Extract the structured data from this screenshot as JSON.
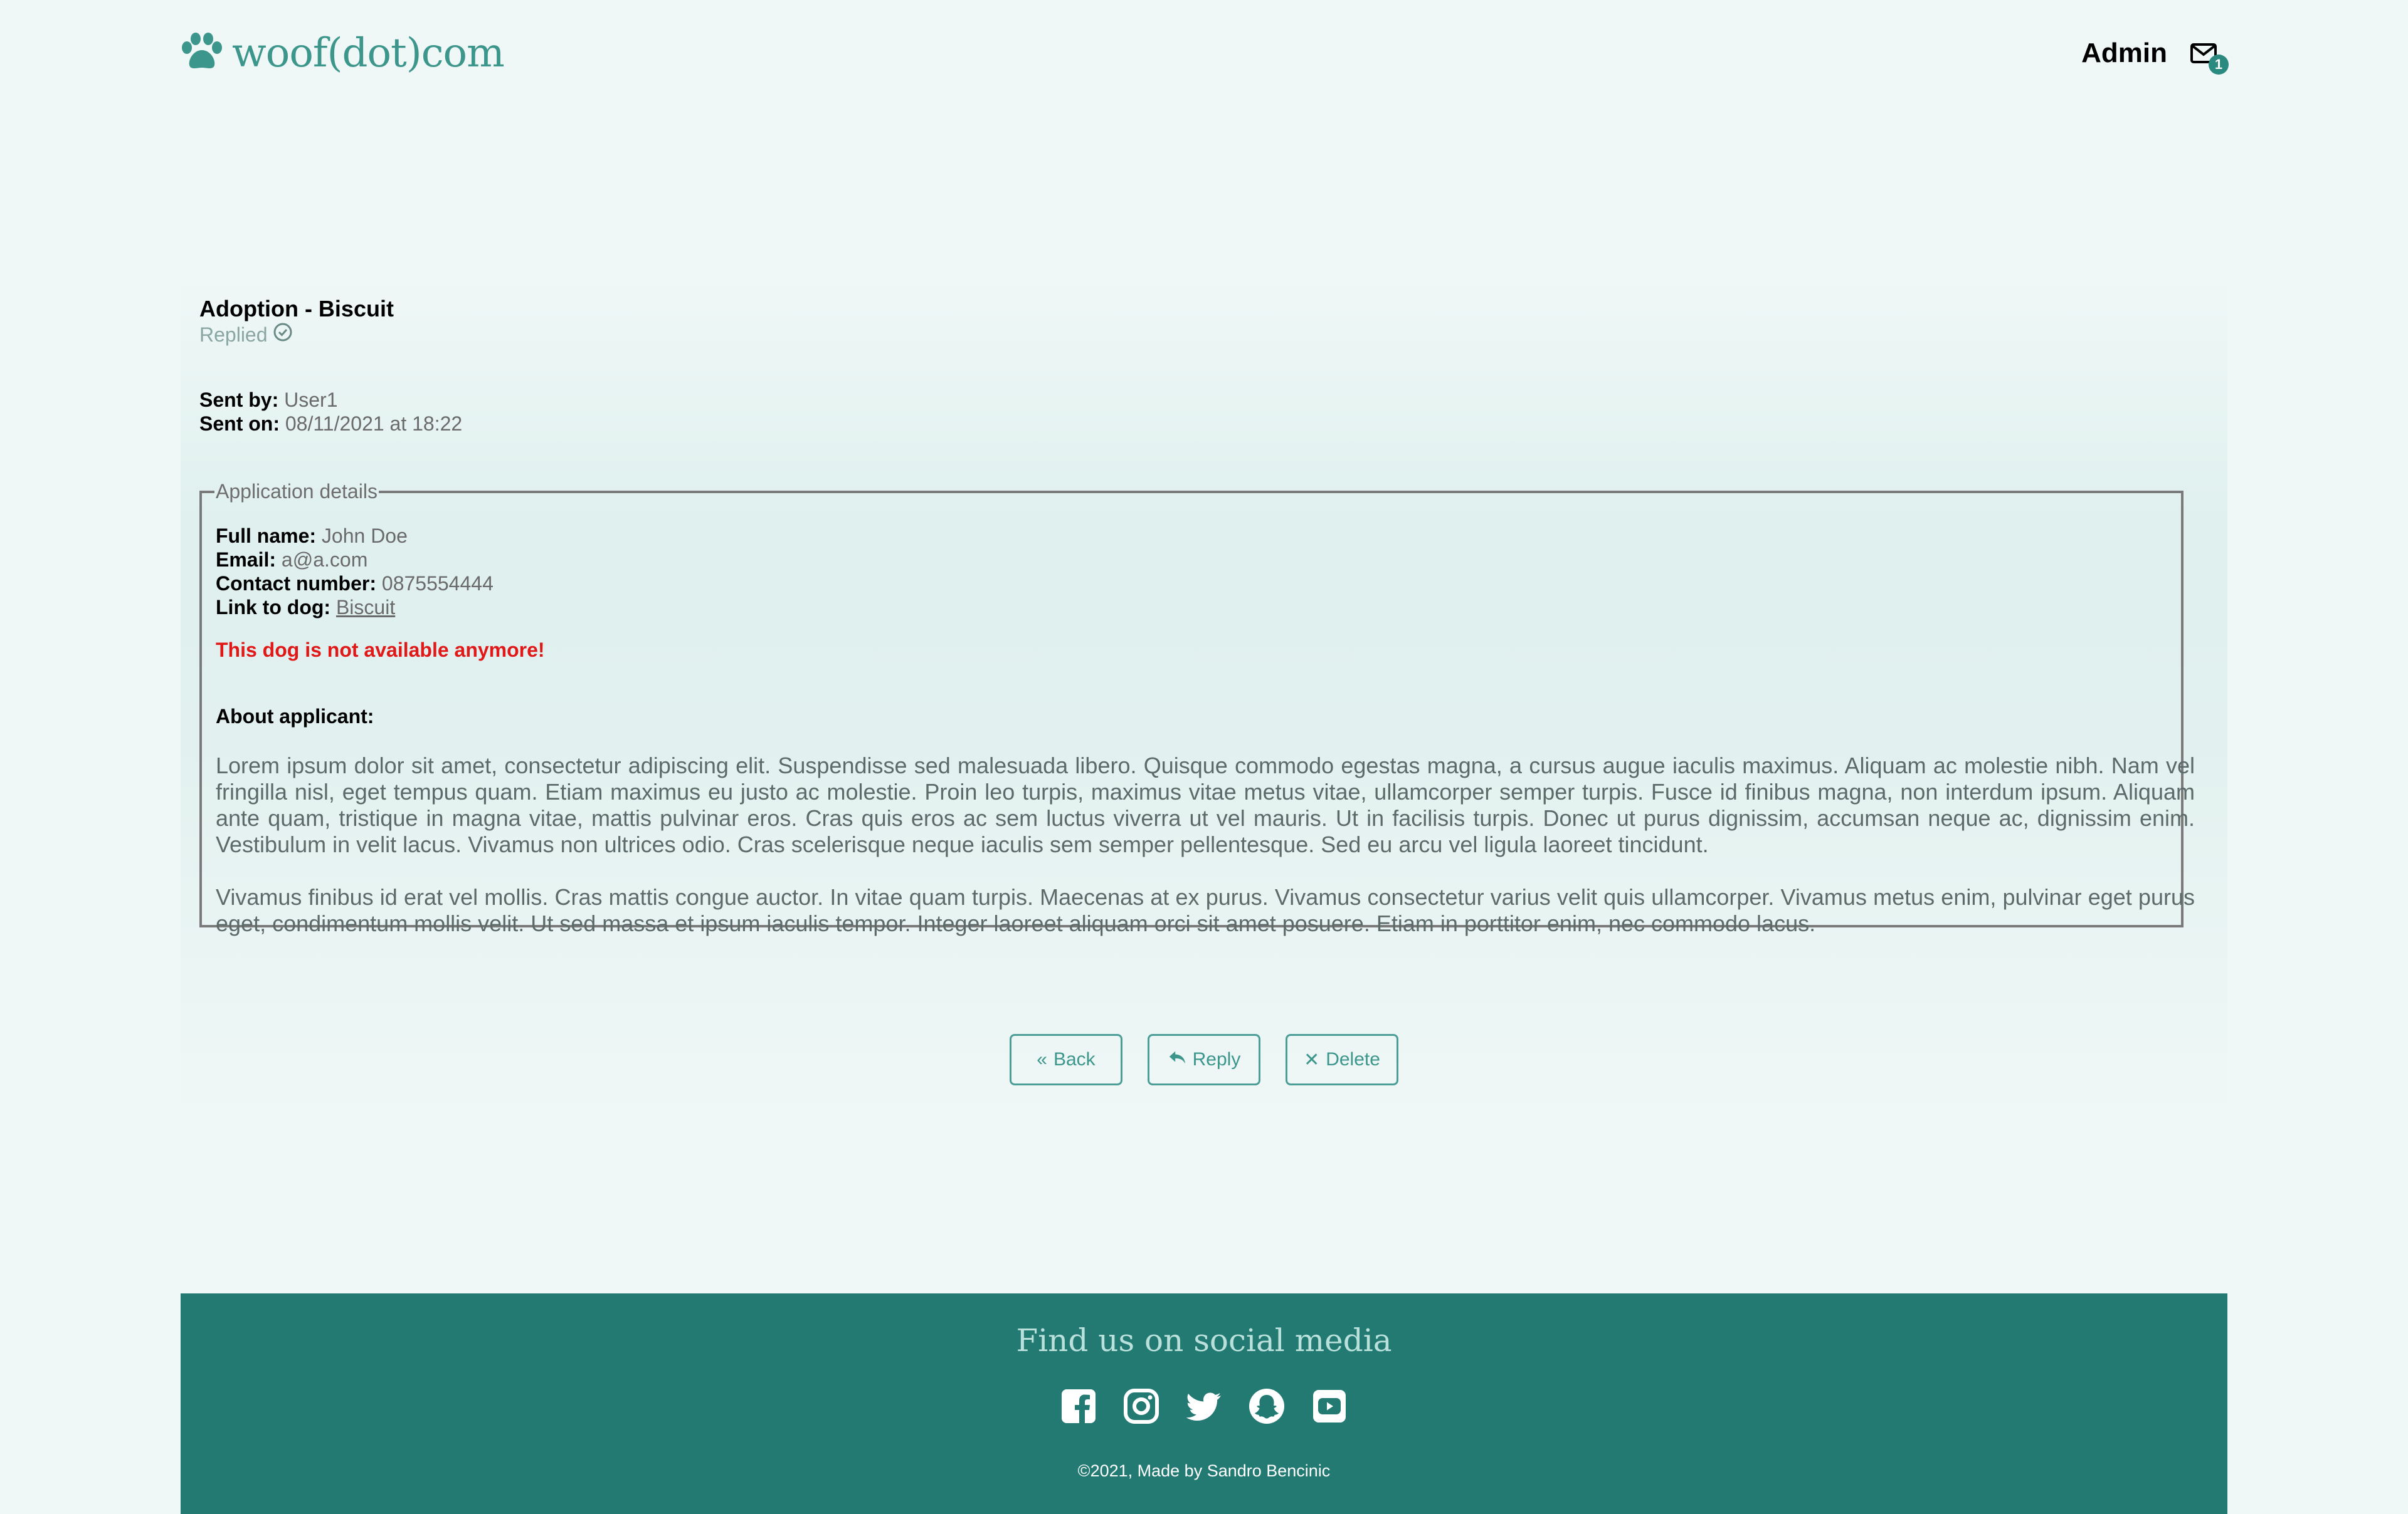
{
  "header": {
    "brand": "woof(dot)com",
    "admin_label": "Admin",
    "mail_count": "1"
  },
  "message": {
    "title": "Adoption - Biscuit",
    "status": "Replied",
    "sent_by_label": "Sent by:",
    "sent_by": "User1",
    "sent_on_label": "Sent on:",
    "sent_on": "08/11/2021 at 18:22"
  },
  "application": {
    "legend": "Application details",
    "full_name_label": "Full name:",
    "full_name": "John Doe",
    "email_label": "Email:",
    "email": "a@a.com",
    "contact_label": "Contact number:",
    "contact": "0875554444",
    "dog_label": "Link to dog:",
    "dog_link": "Biscuit",
    "warning": "This dog is not available anymore!",
    "about_label": "About applicant:",
    "paragraphs": [
      "Lorem ipsum dolor sit amet, consectetur adipiscing elit. Suspendisse sed malesuada libero. Quisque commodo egestas magna, a cursus augue iaculis maximus. Aliquam ac molestie nibh. Nam vel fringilla nisl, eget tempus quam. Etiam maximus eu justo ac molestie. Proin leo turpis, maximus vitae metus vitae, ullamcorper semper turpis. Fusce id finibus magna, non interdum ipsum. Aliquam ante quam, tristique in magna vitae, mattis pulvinar eros. Cras quis eros ac sem luctus viverra ut vel mauris. Ut in facilisis turpis. Donec ut purus dignissim, accumsan neque ac, dignissim enim. Vestibulum in velit lacus. Vivamus non ultrices odio. Cras scelerisque neque iaculis sem semper pellentesque. Sed eu arcu vel ligula laoreet tincidunt.",
      "Vivamus finibus id erat vel mollis. Cras mattis congue auctor. In vitae quam turpis. Maecenas at ex purus. Vivamus consectetur varius velit quis ullamcorper. Vivamus metus enim, pulvinar eget purus eget, condimentum mollis velit. Ut sed massa et ipsum iaculis tempor. Integer laoreet aliquam orci sit amet posuere. Etiam in porttitor enim, nec commodo lacus."
    ]
  },
  "actions": {
    "back": "Back",
    "reply": "Reply",
    "delete": "Delete"
  },
  "footer": {
    "title": "Find us on social media",
    "icons": [
      "facebook-icon",
      "instagram-icon",
      "twitter-icon",
      "snapchat-icon",
      "youtube-icon"
    ],
    "copyright": "©2021, Made by Sandro Bencinic"
  },
  "colors": {
    "background": "#f0f8f7",
    "brand": "#3d968c",
    "footer": "#237a73",
    "warning": "#e01818"
  }
}
